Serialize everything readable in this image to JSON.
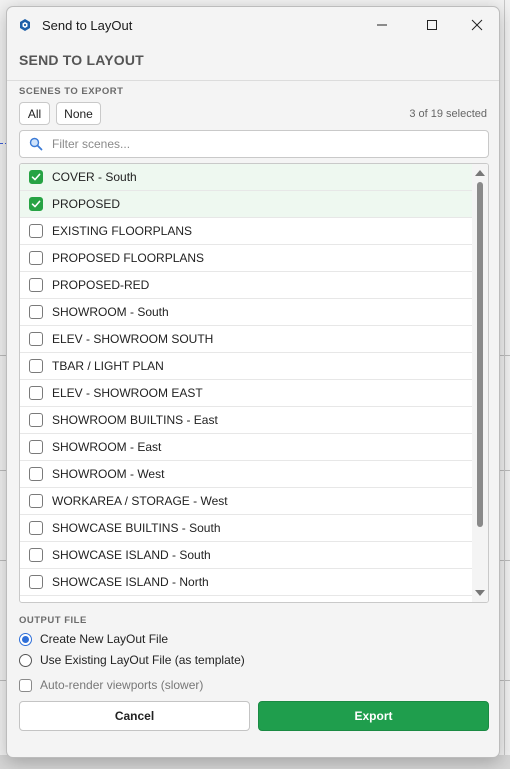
{
  "window": {
    "title": "Send to LayOut",
    "icon": "sketchup-logo-icon"
  },
  "dialog": {
    "heading": "SEND TO LAYOUT"
  },
  "scenes": {
    "section_label": "SCENES TO EXPORT",
    "all_label": "All",
    "none_label": "None",
    "selected_count": "3 of 19 selected",
    "filter_placeholder": "Filter scenes...",
    "items": [
      {
        "label": "COVER - South",
        "checked": true
      },
      {
        "label": "PROPOSED",
        "checked": true
      },
      {
        "label": "EXISTING FLOORPLANS",
        "checked": false
      },
      {
        "label": "PROPOSED FLOORPLANS",
        "checked": false
      },
      {
        "label": "PROPOSED-RED",
        "checked": false
      },
      {
        "label": "SHOWROOM - South",
        "checked": false
      },
      {
        "label": "ELEV - SHOWROOM SOUTH",
        "checked": false
      },
      {
        "label": "TBAR / LIGHT PLAN",
        "checked": false
      },
      {
        "label": "ELEV - SHOWROOM EAST",
        "checked": false
      },
      {
        "label": "SHOWROOM BUILTINS - East",
        "checked": false
      },
      {
        "label": "SHOWROOM - East",
        "checked": false
      },
      {
        "label": "SHOWROOM - West",
        "checked": false
      },
      {
        "label": "WORKAREA / STORAGE - West",
        "checked": false
      },
      {
        "label": "SHOWCASE BUILTINS - South",
        "checked": false
      },
      {
        "label": "SHOWCASE ISLAND - South",
        "checked": false
      },
      {
        "label": "SHOWCASE ISLAND - North",
        "checked": false
      }
    ]
  },
  "output": {
    "section_label": "OUTPUT FILE",
    "option_new": "Create New LayOut File",
    "option_existing": "Use Existing LayOut File (as template)",
    "selected_option": "new",
    "auto_render_label": "Auto-render viewports (slower)",
    "auto_render_checked": false
  },
  "actions": {
    "cancel_label": "Cancel",
    "export_label": "Export"
  },
  "colors": {
    "accent_green": "#1f9e4d",
    "checkbox_green": "#27a344",
    "radio_blue": "#2f6fd8"
  }
}
